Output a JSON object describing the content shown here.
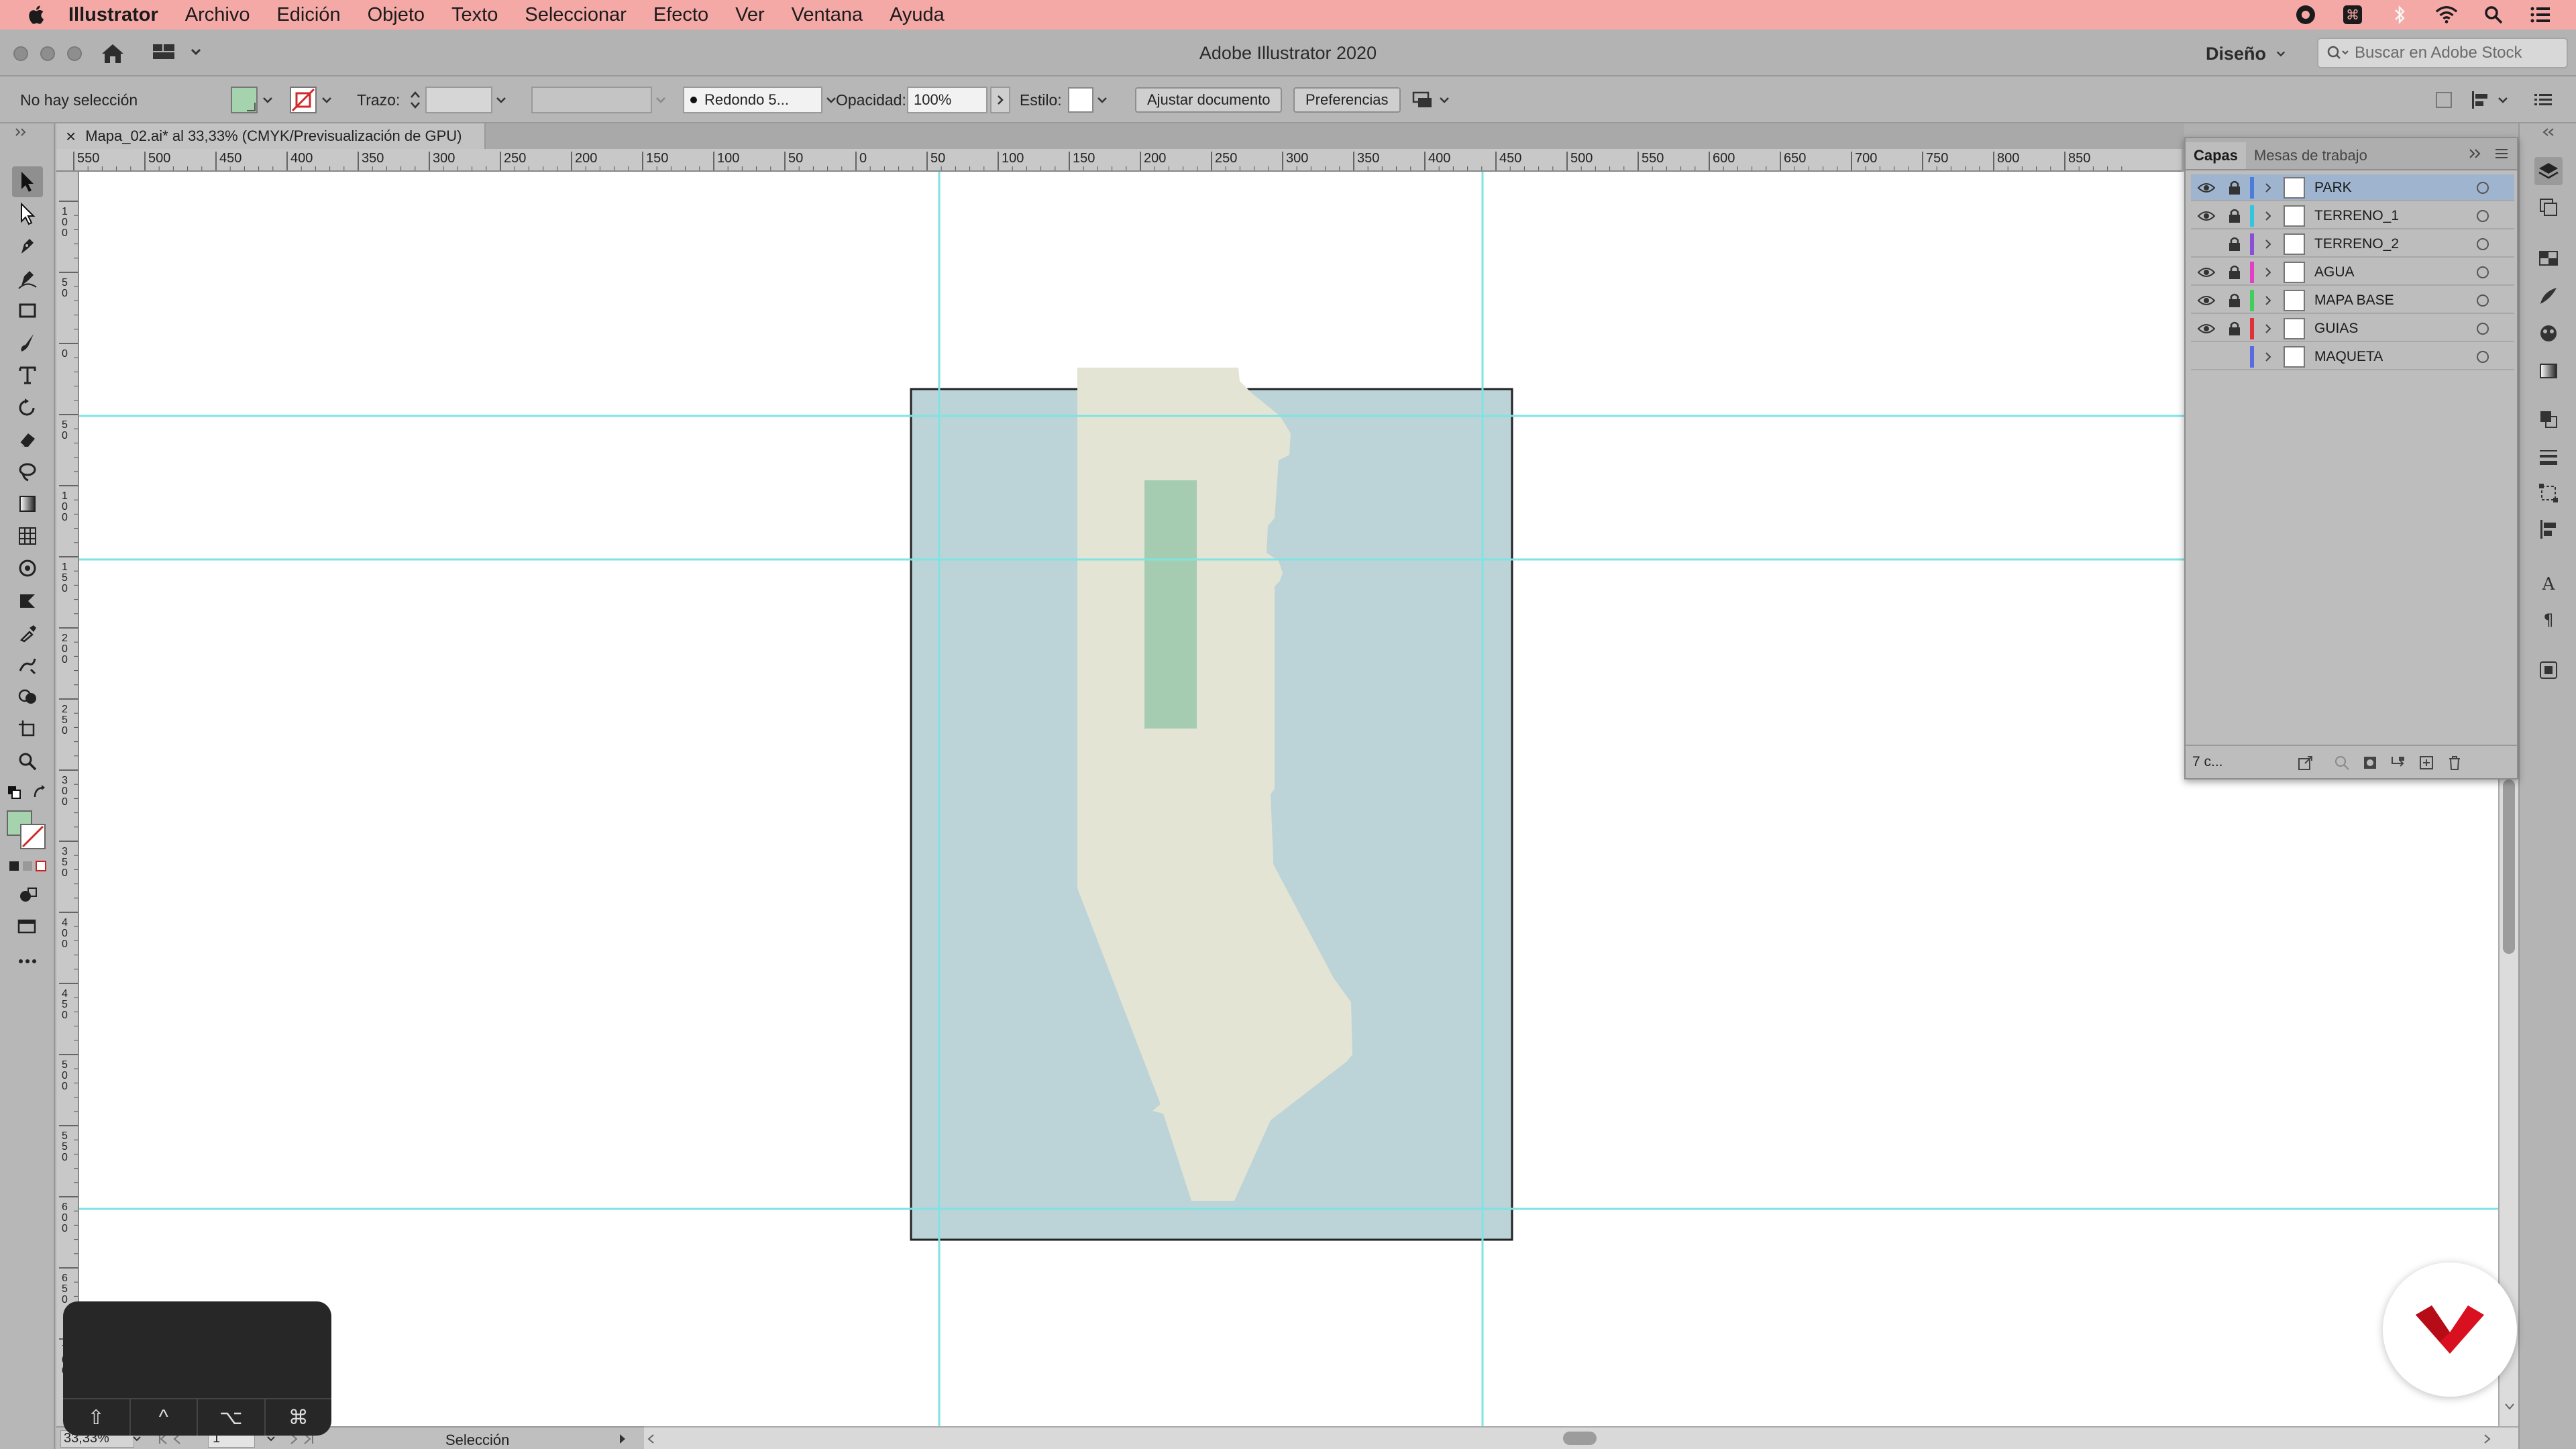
{
  "menubar": {
    "app_name": "Illustrator",
    "items": [
      "Archivo",
      "Edición",
      "Objeto",
      "Texto",
      "Seleccionar",
      "Efecto",
      "Ver",
      "Ventana",
      "Ayuda"
    ]
  },
  "titlebar": {
    "title": "Adobe Illustrator 2020",
    "workspace": "Diseño",
    "search_placeholder": "Buscar en Adobe Stock"
  },
  "controlbar": {
    "selection_status": "No hay selección",
    "stroke_label": "Trazo:",
    "brush_value": "Redondo 5...",
    "opacity_label": "Opacidad:",
    "opacity_value": "100%",
    "style_label": "Estilo:",
    "fit_button": "Ajustar documento",
    "prefs_button": "Preferencias"
  },
  "document": {
    "tab_title": "Mapa_02.ai* al 33,33% (CMYK/Previsualización de GPU)",
    "close_glyph": "×"
  },
  "ruler_h_labels": [
    "550",
    "500",
    "450",
    "400",
    "350",
    "300",
    "250",
    "200",
    "150",
    "100",
    "50",
    "0",
    "50",
    "100",
    "150",
    "200",
    "250",
    "300",
    "350",
    "400",
    "450",
    "500",
    "550",
    "600",
    "650",
    "700",
    "750",
    "800",
    "850"
  ],
  "ruler_v_labels": [
    "1 0 0",
    "5 0",
    "0",
    "5 0",
    "1 0 0",
    "1 5 0",
    "2 0 0",
    "2 5 0",
    "3 0 0",
    "3 5 0",
    "4 0 0",
    "4 5 0",
    "5 0 0",
    "5 5 0",
    "6 0 0",
    "6 5 0",
    "7 0 0"
  ],
  "layers_panel": {
    "tabs": [
      "Capas",
      "Mesas de trabajo"
    ],
    "layers": [
      {
        "name": "PARK",
        "color": "#4c7bd9",
        "visible": true,
        "locked": true,
        "selected": true
      },
      {
        "name": "TERRENO_1",
        "color": "#33c4e0",
        "visible": true,
        "locked": true,
        "selected": false
      },
      {
        "name": "TERRENO_2",
        "color": "#8a4fd6",
        "visible": false,
        "locked": true,
        "selected": false
      },
      {
        "name": "AGUA",
        "color": "#e040c4",
        "visible": true,
        "locked": true,
        "selected": false
      },
      {
        "name": "MAPA BASE",
        "color": "#3fcf5a",
        "visible": true,
        "locked": true,
        "selected": false
      },
      {
        "name": "GUIAS",
        "color": "#e0303a",
        "visible": true,
        "locked": true,
        "selected": false
      },
      {
        "name": "MAQUETA",
        "color": "#5a6be0",
        "visible": false,
        "locked": false,
        "selected": false
      }
    ],
    "count_label": "7 c..."
  },
  "statusbar": {
    "zoom": "33,33%",
    "artboard": "1",
    "tool": "Selección"
  },
  "touchbar": {
    "keys": [
      "⇧",
      "^",
      "⌥",
      "⌘"
    ]
  },
  "colors": {
    "water": "#bcd3d8",
    "land": "#e3e4d4",
    "park": "#a5ccb0",
    "guide": "#7fe3e3",
    "fill_swatch": "#a5d3ad"
  }
}
